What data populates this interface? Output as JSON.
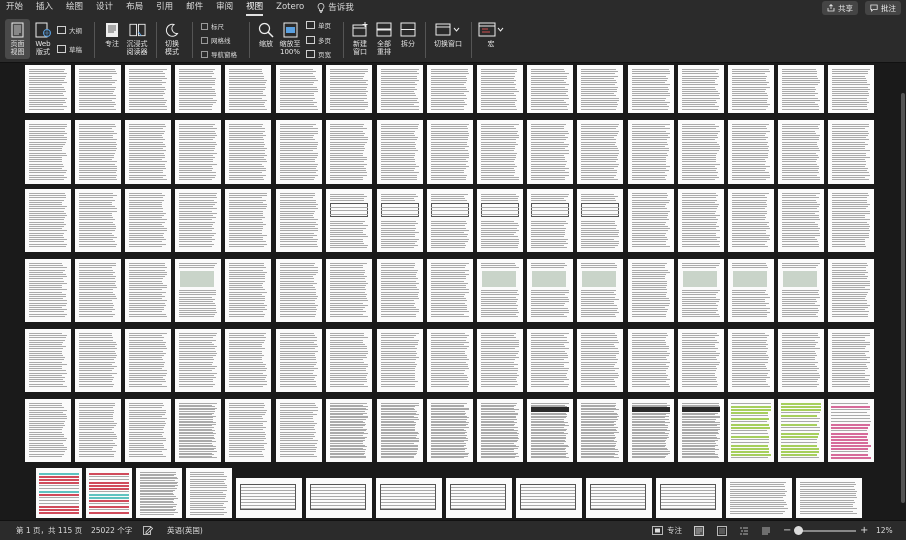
{
  "menu": {
    "tabs": [
      "开始",
      "插入",
      "绘图",
      "设计",
      "布局",
      "引用",
      "邮件",
      "审阅",
      "视图",
      "Zotero"
    ],
    "active_tab": "视图",
    "tell_me": "告诉我",
    "share": "共享",
    "comments": "批注"
  },
  "ribbon": {
    "page_view": [
      "页面",
      "视图"
    ],
    "web_view": [
      "Web",
      "版式"
    ],
    "outline": "大纲",
    "draft": "草稿",
    "focus": "专注",
    "immersive": [
      "沉浸式",
      "阅读器"
    ],
    "toggle_mode": [
      "切换",
      "模式"
    ],
    "ruler": "标尺",
    "gridlines": "网格线",
    "nav_pane": "导航窗格",
    "zoom": "缩放",
    "zoom100": [
      "缩放至",
      "100%"
    ],
    "one_page": "单页",
    "multi_page": "多页",
    "page_width": "页宽",
    "new_window": [
      "新建",
      "窗口"
    ],
    "arrange_all": [
      "全部",
      "重排"
    ],
    "split": "拆分",
    "switch_window": "切换窗口",
    "macros": "宏"
  },
  "status": {
    "page_info": "第 1 页，共 115 页",
    "word_count": "25022 个字",
    "language": "英语(英国)",
    "focus": "专注",
    "zoom_level": "12%"
  },
  "colors": {
    "background": "#1e1e1e",
    "ribbon": "#2b2b2b",
    "page": "#fbfbfb",
    "pink_highlight": "#d66b9a",
    "green_highlight": "#a6cf5d",
    "teal_highlight": "#5fc3c1"
  },
  "document": {
    "total_pages": 115
  }
}
